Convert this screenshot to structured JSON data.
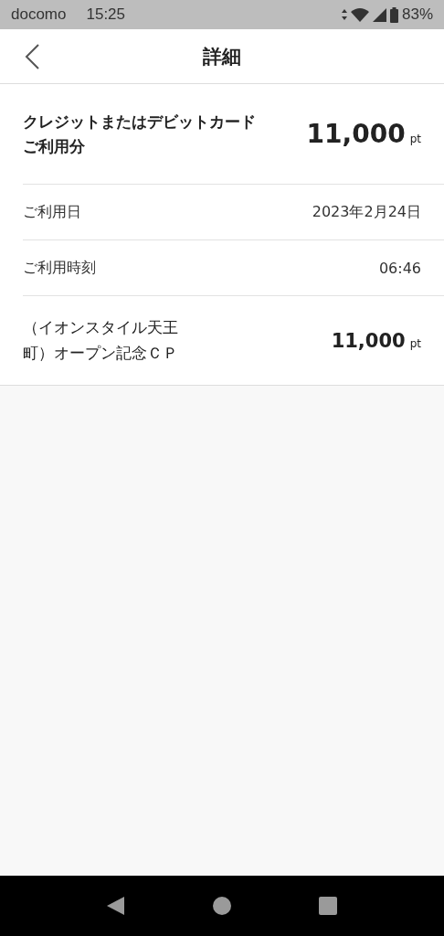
{
  "status_bar": {
    "carrier": "docomo",
    "time": "15:25",
    "battery": "83%"
  },
  "header": {
    "title": "詳細"
  },
  "rows": [
    {
      "kind": "summary",
      "label": "クレジットまたはデビットカードご利用分",
      "value": "11,000",
      "unit": "pt"
    },
    {
      "kind": "info",
      "label": "ご利用日",
      "value": "2023年2月24日"
    },
    {
      "kind": "info",
      "label": "ご利用時刻",
      "value": "06:46"
    },
    {
      "kind": "amount",
      "label": "（イオンスタイル天王町）オープン記念ＣＰ",
      "value": "11,000",
      "unit": "pt"
    }
  ]
}
